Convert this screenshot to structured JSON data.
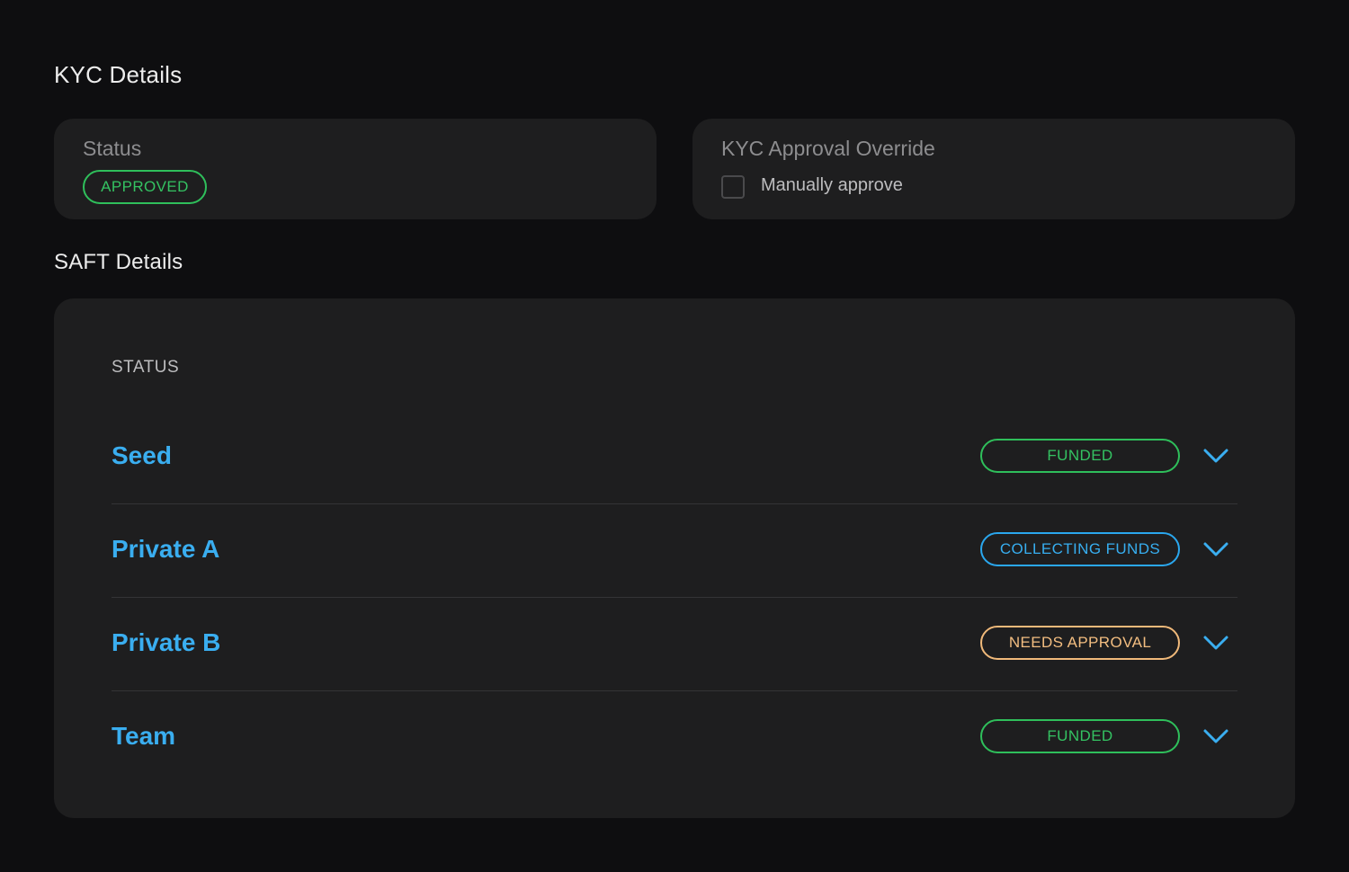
{
  "kyc": {
    "title": "KYC Details",
    "status_label": "Status",
    "status_value": "APPROVED",
    "override_label": "KYC Approval Override",
    "manual_approve_label": "Manually approve"
  },
  "saft": {
    "title": "SAFT Details",
    "column_header": "STATUS",
    "rows": [
      {
        "name": "Seed",
        "status": "FUNDED",
        "status_color": "#34c262"
      },
      {
        "name": "Private A",
        "status": "COLLECTING FUNDS",
        "status_color": "#37aef0"
      },
      {
        "name": "Private B",
        "status": "NEEDS APPROVAL",
        "status_color": "#f2bd80"
      },
      {
        "name": "Team",
        "status": "FUNDED",
        "status_color": "#34c262"
      }
    ]
  },
  "icons": {
    "expand": "chevron-down-icon"
  },
  "colors": {
    "accent": "#3aaef0",
    "success": "#34c262",
    "warning": "#f2bd80",
    "card_bg": "#1e1e1f",
    "page_bg": "#0e0e10"
  }
}
